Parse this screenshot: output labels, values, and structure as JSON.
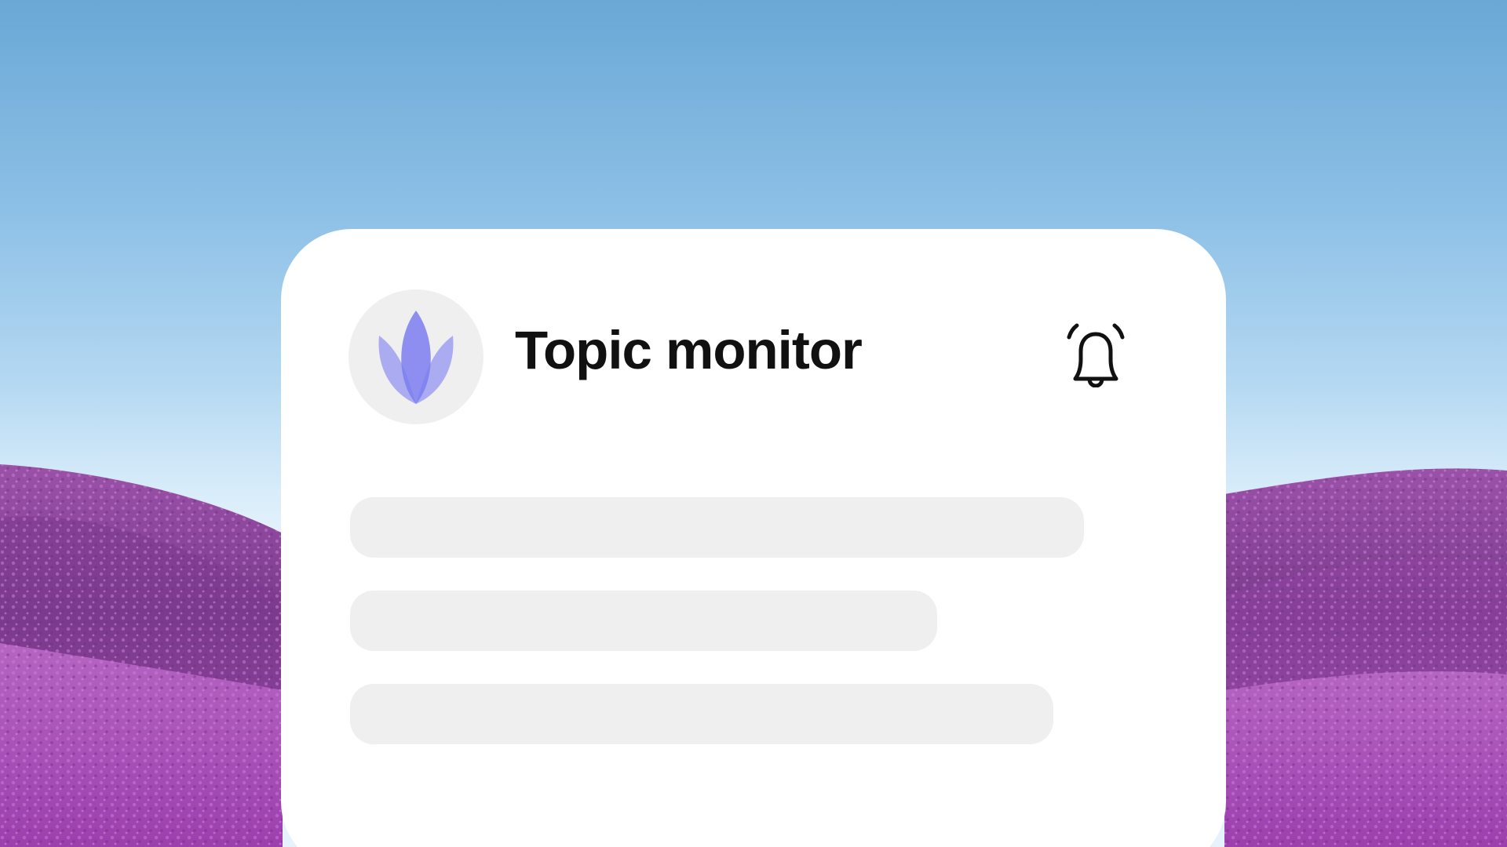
{
  "app": {
    "title": "Topic monitor"
  },
  "icons": {
    "logo": "lotus-logo-icon",
    "notification": "bell-icon"
  },
  "colors": {
    "logo_petal": "#7b7df0",
    "card_background": "#ffffff",
    "skeleton": "#efefef",
    "flower_field": "#a64fb4",
    "sky": "#8dc0e6"
  },
  "skeleton_lines": [
    {
      "fraction": 1.0
    },
    {
      "fraction": 0.8
    },
    {
      "fraction": 0.96
    }
  ]
}
